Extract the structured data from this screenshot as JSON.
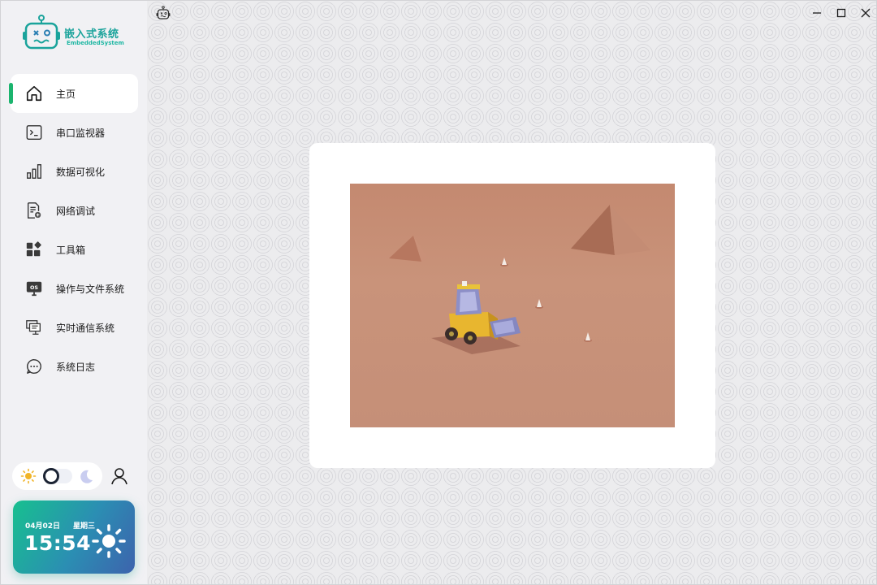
{
  "app": {
    "title": "嵌入式系统",
    "subtitle": "EmbeddedSystem"
  },
  "sidebar": {
    "items": [
      {
        "label": "主页",
        "icon": "home-icon",
        "active": true
      },
      {
        "label": "串口监视器",
        "icon": "terminal-icon",
        "active": false
      },
      {
        "label": "数据可视化",
        "icon": "bar-chart-icon",
        "active": false
      },
      {
        "label": "网络调试",
        "icon": "network-doc-icon",
        "active": false
      },
      {
        "label": "工具箱",
        "icon": "toolbox-icon",
        "active": false
      },
      {
        "label": "操作与文件系统",
        "icon": "os-monitor-icon",
        "active": false
      },
      {
        "label": "实时通信系统",
        "icon": "communication-icon",
        "active": false
      },
      {
        "label": "系统日志",
        "icon": "chat-log-icon",
        "active": false
      }
    ],
    "accent_color": "#1bb46e"
  },
  "theme_toggle": {
    "mode": "light",
    "light_icon": "sun-icon",
    "dark_icon": "moon-icon"
  },
  "clock": {
    "date": "04月02日",
    "weekday": "星期三",
    "time": "15:54",
    "weather_icon": "sun-icon"
  },
  "window_controls": [
    "minimize-icon",
    "maximize-icon",
    "close-icon"
  ],
  "main": {
    "image": "desert-bulldozer-illustration"
  }
}
